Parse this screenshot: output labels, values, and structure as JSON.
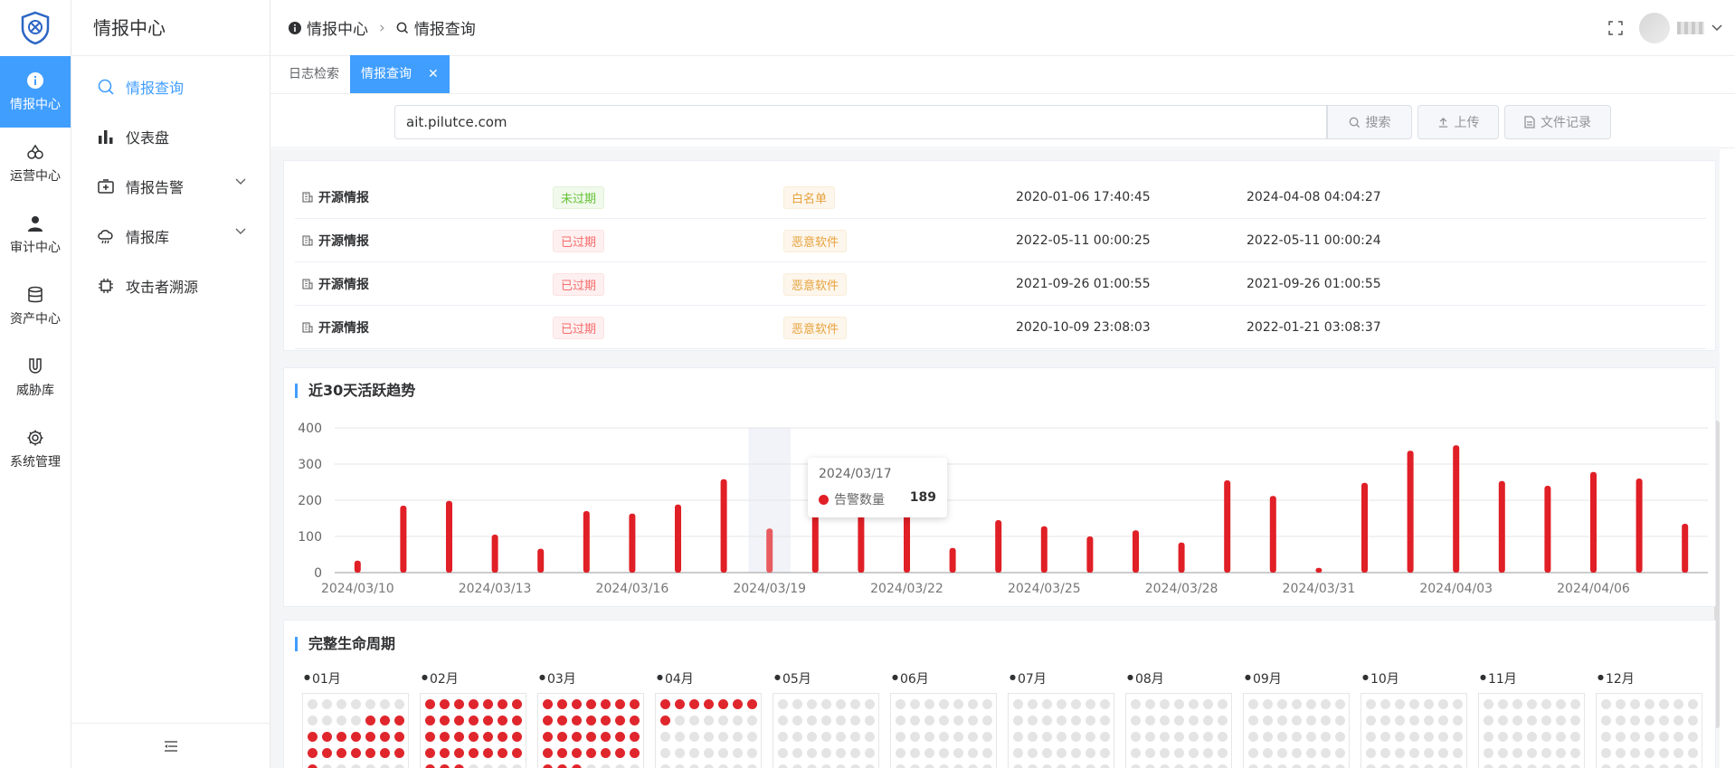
{
  "colors": {
    "accent": "#409eff",
    "bar": "#e01f26",
    "dot_active": "#e0262d",
    "dot_inactive": "#e4e4e4"
  },
  "rail": {
    "items": [
      {
        "label": "情报中心",
        "icon": "info-icon",
        "active": true
      },
      {
        "label": "运营中心",
        "icon": "link-icon"
      },
      {
        "label": "审计中心",
        "icon": "user-icon"
      },
      {
        "label": "资产中心",
        "icon": "database-icon"
      },
      {
        "label": "威胁库",
        "icon": "magnet-icon"
      },
      {
        "label": "系统管理",
        "icon": "gear-icon"
      }
    ]
  },
  "sidebar": {
    "title": "情报中心",
    "items": [
      {
        "label": "情报查询",
        "icon": "search-icon",
        "active": true
      },
      {
        "label": "仪表盘",
        "icon": "bar-chart-icon"
      },
      {
        "label": "情报告警",
        "icon": "alarm-icon",
        "expandable": true
      },
      {
        "label": "情报库",
        "icon": "cloud-icon",
        "expandable": true
      },
      {
        "label": "攻击者溯源",
        "icon": "chip-icon"
      }
    ]
  },
  "header": {
    "breadcrumb": [
      "情报中心",
      "情报查询"
    ]
  },
  "tabs": [
    {
      "label": "日志检索",
      "active": false
    },
    {
      "label": "情报查询",
      "active": true
    }
  ],
  "search": {
    "value": "ait.pilutce.com",
    "search_label": "搜索",
    "upload_label": "上传",
    "file_label": "文件记录"
  },
  "table": {
    "rows": [
      {
        "source": "开源情报",
        "status": "未过期",
        "status_type": "green",
        "category": "白名单",
        "first_seen": "2020-01-06 17:40:45",
        "last_seen": "2024-04-08 04:04:27"
      },
      {
        "source": "开源情报",
        "status": "已过期",
        "status_type": "red",
        "category": "恶意软件",
        "first_seen": "2022-05-11 00:00:25",
        "last_seen": "2022-05-11 00:00:24"
      },
      {
        "source": "开源情报",
        "status": "已过期",
        "status_type": "red",
        "category": "恶意软件",
        "first_seen": "2021-09-26 01:00:55",
        "last_seen": "2021-09-26 01:00:55"
      },
      {
        "source": "开源情报",
        "status": "已过期",
        "status_type": "red",
        "category": "恶意软件",
        "first_seen": "2020-10-09 23:08:03",
        "last_seen": "2022-01-21 03:08:37"
      }
    ]
  },
  "trend": {
    "title": "近30天活跃趋势",
    "tooltip": {
      "date": "2024/03/17",
      "series": "告警数量",
      "value": "189"
    }
  },
  "chart_data": {
    "type": "bar",
    "title": "近30天活跃趋势",
    "series": [
      {
        "name": "告警数量",
        "values": [
          33,
          185,
          198,
          105,
          66,
          170,
          163,
          188,
          258,
          122,
          189,
          195,
          160,
          68,
          145,
          128,
          100,
          117,
          83,
          255,
          212,
          13,
          248,
          337,
          352,
          253,
          240,
          278,
          260,
          135
        ]
      }
    ],
    "categories": [
      "2024/03/10",
      "2024/03/11",
      "2024/03/12",
      "2024/03/13",
      "2024/03/14",
      "2024/03/15",
      "2024/03/16",
      "2024/03/17",
      "2024/03/18",
      "2024/03/19",
      "2024/03/20",
      "2024/03/21",
      "2024/03/22",
      "2024/03/23",
      "2024/03/24",
      "2024/03/25",
      "2024/03/26",
      "2024/03/27",
      "2024/03/28",
      "2024/03/29",
      "2024/03/30",
      "2024/03/31",
      "2024/04/01",
      "2024/04/02",
      "2024/04/03",
      "2024/04/04",
      "2024/04/05",
      "2024/04/06",
      "2024/04/07",
      "2024/04/08"
    ],
    "tick_labels": [
      "2024/03/10",
      "2024/03/13",
      "2024/03/16",
      "2024/03/19",
      "2024/03/22",
      "2024/03/25",
      "2024/03/28",
      "2024/03/31",
      "2024/04/03",
      "2024/04/06"
    ],
    "ylim": [
      0,
      400
    ],
    "yticks": [
      "0",
      "100",
      "200",
      "300",
      "400"
    ],
    "highlight_index": 9,
    "grid": true
  },
  "lifecycle": {
    "title": "完整生命周期",
    "months": [
      {
        "label": "01月",
        "active": [
          11,
          12,
          13,
          14,
          15,
          16,
          17,
          18,
          19,
          20,
          21,
          22,
          23,
          24,
          25,
          26,
          27,
          28
        ]
      },
      {
        "label": "02月",
        "active": "all"
      },
      {
        "label": "03月",
        "active": "all"
      },
      {
        "label": "04月",
        "active": [
          0,
          1,
          2,
          3,
          4,
          5,
          6,
          7
        ]
      },
      {
        "label": "05月",
        "active": []
      },
      {
        "label": "06月",
        "active": []
      },
      {
        "label": "07月",
        "active": []
      },
      {
        "label": "08月",
        "active": []
      },
      {
        "label": "09月",
        "active": []
      },
      {
        "label": "10月",
        "active": []
      },
      {
        "label": "11月",
        "active": []
      },
      {
        "label": "12月",
        "active": []
      }
    ]
  }
}
